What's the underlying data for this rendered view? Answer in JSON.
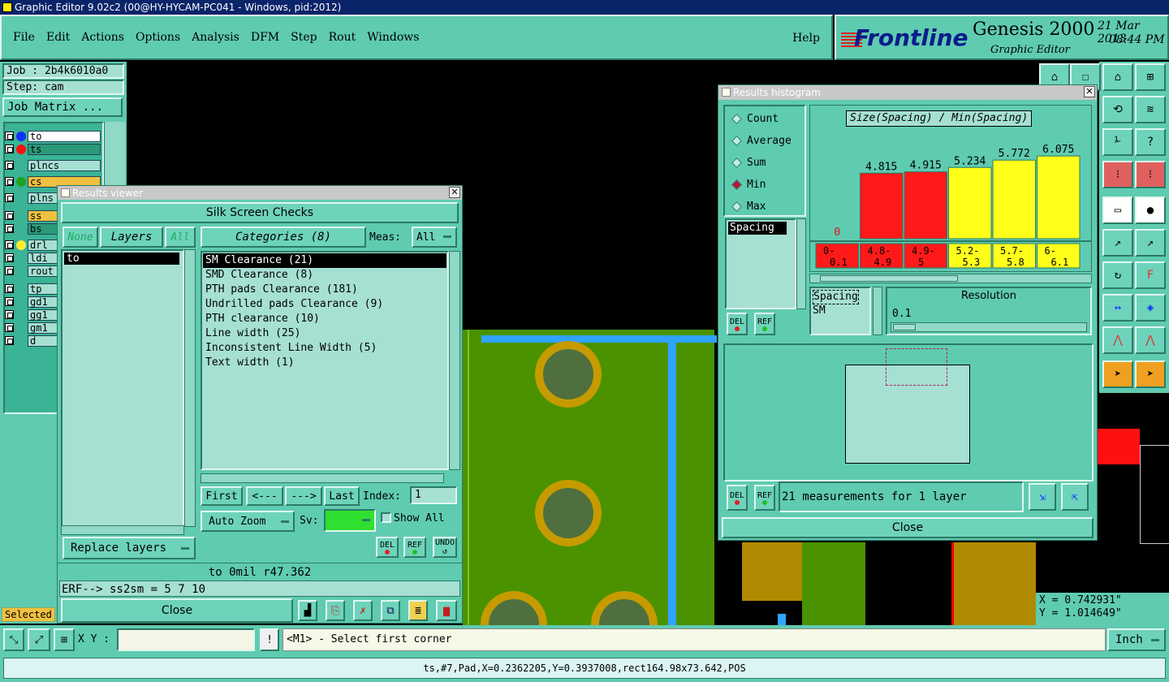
{
  "titlebar": {
    "title": "Graphic Editor 9.02c2 (00@HY-HYCAM-PC041 - Windows, pid:2012)"
  },
  "menu": {
    "items": [
      "File",
      "Edit",
      "Actions",
      "Options",
      "Analysis",
      "DFM",
      "Step",
      "Rout",
      "Windows"
    ],
    "help": "Help"
  },
  "brand": {
    "logo": "Frontline",
    "product": "Genesis 2000",
    "subtitle": "Graphic Editor",
    "date": "21 Mar 2013",
    "time": "08:44 PM"
  },
  "job": {
    "job": "Job : 2b4k6010a0",
    "step": "Step: cam",
    "matrix_button": "Job Matrix ..."
  },
  "layers": [
    {
      "name": "to",
      "color": "#1030ff",
      "bg": "#ffffff"
    },
    {
      "name": "ts",
      "color": "#ff1010",
      "bg": "#2a9a78"
    },
    {
      "name": "plncs",
      "color": "",
      "bg": "#a6e0d3"
    },
    {
      "name": "cs",
      "color": "#1fa21f",
      "bg": "#f0c040"
    },
    {
      "name": "plns",
      "color": "",
      "bg": "#a6e0d3"
    },
    {
      "name": "ss",
      "color": "",
      "bg": "#f0c040"
    },
    {
      "name": "bs",
      "color": "",
      "bg": "#2a9a78"
    },
    {
      "name": "drl",
      "color": "#ffee30",
      "bg": "#a6e0d3"
    },
    {
      "name": "ldi",
      "color": "",
      "bg": "#a6e0d3"
    },
    {
      "name": "rout",
      "color": "",
      "bg": "#a6e0d3"
    },
    {
      "name": "tp",
      "color": "",
      "bg": "#a6e0d3"
    },
    {
      "name": "gd1",
      "color": "",
      "bg": "#a6e0d3"
    },
    {
      "name": "gg1",
      "color": "",
      "bg": "#a6e0d3"
    },
    {
      "name": "gm1",
      "color": "",
      "bg": "#a6e0d3"
    },
    {
      "name": "d",
      "color": "",
      "bg": "#a6e0d3"
    }
  ],
  "selected_label": "Selected",
  "results_viewer": {
    "title": "Results viewer",
    "header": "Silk Screen Checks",
    "none": "None",
    "layers": "Layers",
    "all": "All",
    "layer_list": [
      "to"
    ],
    "categories_button": "Categories (8)",
    "meas_label": "Meas:",
    "meas_value": "All",
    "categories": [
      "SM Clearance (21)",
      "SMD Clearance (8)",
      "PTH pads Clearance (181)",
      "Undrilled pads Clearance (9)",
      "PTH clearance (10)",
      "Line width (25)",
      "Inconsistent Line Width (5)",
      "Text width (1)"
    ],
    "nav": {
      "first": "First",
      "prev": "<---",
      "next": "--->",
      "last": "Last",
      "index_label": "Index:",
      "index_value": "1"
    },
    "auto_zoom": "Auto Zoom",
    "sv_label": "Sv:",
    "show_all": "Show All",
    "replace_layers": "Replace layers",
    "del": "DEL",
    "ref": "REF",
    "undo": "UNDO",
    "info": "to 0mil  r47.362",
    "erf": "ERF--> ss2sm = 5 7 10",
    "close": "Close"
  },
  "histogram": {
    "title": "Results histogram",
    "options": [
      "Count",
      "Average",
      "Sum",
      "Min",
      "Max"
    ],
    "selected_option": "Min",
    "chart_title": "Size(Spacing) / Min(Spacing)",
    "list_items": [
      "Spacing"
    ],
    "spacing_box": [
      "Spacing",
      "SM"
    ],
    "resolution_label": "Resolution",
    "resolution_value": "0.1",
    "status": "21 measurements for 1 layer",
    "del": "DEL",
    "ref": "REF",
    "close": "Close"
  },
  "chart_data": {
    "type": "bar",
    "title": "Size(Spacing) / Min(Spacing)",
    "categories": [
      "0-\n0.1",
      "4.8-\n4.9",
      "4.9-\n5",
      "5.2-\n5.3",
      "5.7-\n5.8",
      "6-\n6.1"
    ],
    "values": [
      0,
      4.815,
      4.915,
      5.234,
      5.772,
      6.075
    ],
    "labels": [
      "0",
      "4.815",
      "4.915",
      "5.234",
      "5.772",
      "6.075"
    ],
    "colors": [
      "#ff1a1a",
      "#ff1a1a",
      "#ff1a1a",
      "#ffff1a",
      "#ffff1a",
      "#ffff1a"
    ],
    "ylim": [
      0,
      6.8
    ]
  },
  "coords": {
    "x": "X = 0.742931\"",
    "y": "Y = 1.014649\""
  },
  "bottom": {
    "xy_label": "X Y :",
    "prompt": "<M1> - Select first corner",
    "units": "Inch",
    "status": "ts,#7,Pad,X=0.2362205,Y=0.3937008,rect164.98x73.642,POS"
  }
}
